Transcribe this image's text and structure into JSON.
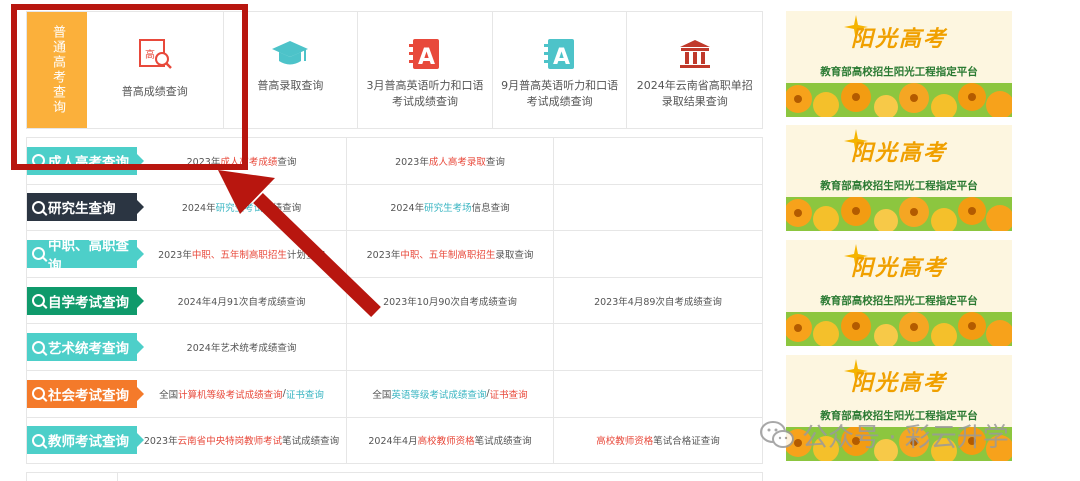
{
  "top_cards": {
    "tab_label": "普通高考查询",
    "cards": [
      {
        "label": "普高成绩查询",
        "icon": "score-search-icon"
      },
      {
        "label": "普高录取查询",
        "icon": "graduation-cap-icon"
      },
      {
        "label": "3月普高英语听力和口语考试成绩查询",
        "icon": "english-a-icon"
      },
      {
        "label": "9月普高英语听力和口语考试成绩查询",
        "icon": "english-a-icon"
      },
      {
        "label": "2024年云南省高职单招录取结果查询",
        "icon": "building-icon"
      }
    ]
  },
  "rows": [
    {
      "category": "成人高考查询",
      "color": "#4dcfc9",
      "c1": {
        "pre": "2023年",
        "hl": "成人高考成绩",
        "post": "查询",
        "hl_class": "hl-red"
      },
      "c2": {
        "pre": "2023年",
        "hl": "成人高考录取",
        "post": "查询",
        "hl_class": "hl-red"
      },
      "c3": null
    },
    {
      "category": "研究生查询",
      "color": "#2b3542",
      "c1": {
        "pre": "2024年",
        "hl": "研究生考试",
        "post": "成绩查询",
        "hl_class": "hl-teal"
      },
      "c2": {
        "pre": "2024年",
        "hl": "研究生考场",
        "post": "信息查询",
        "hl_class": "hl-teal"
      },
      "c3": null
    },
    {
      "category": "中职、高职查询",
      "color": "#4dcfc9",
      "c1": {
        "pre": "2023年",
        "hl": "中职、五年制高职招生",
        "post": "计划查询",
        "hl_class": "hl-red"
      },
      "c2": {
        "pre": "2023年",
        "hl": "中职、五年制高职招生",
        "post": "录取查询",
        "hl_class": "hl-red"
      },
      "c3": null
    },
    {
      "category": "自学考试查询",
      "color": "#0f9a6b",
      "c1": {
        "pre": "2024年4月91次自考成绩查询",
        "hl": "",
        "post": "",
        "hl_class": ""
      },
      "c2": {
        "pre": "2023年10月90次自考成绩查询",
        "hl": "",
        "post": "",
        "hl_class": ""
      },
      "c3": {
        "pre": "2023年4月89次自考成绩查询",
        "hl": "",
        "post": "",
        "hl_class": ""
      }
    },
    {
      "category": "艺术统考查询",
      "color": "#4dcfc9",
      "c1": {
        "pre": "2024年艺术统考成绩查询",
        "hl": "",
        "post": "",
        "hl_class": ""
      },
      "c2": null,
      "c3": null
    },
    {
      "category": "社会考试查询",
      "color": "#f47a2a",
      "c1": {
        "pre": "全国",
        "hl": "计算机等级考试成绩查询",
        "post": " / ",
        "hl2": "证书查询",
        "hl_class": "hl-red",
        "hl2_class": "hl-teal"
      },
      "c2": {
        "pre": "全国",
        "hl": "英语等级考试成绩查询",
        "post": " / ",
        "hl2": "证书查询",
        "hl_class": "hl-teal",
        "hl2_class": "hl-red"
      },
      "c3": null
    },
    {
      "category": "教师考试查询",
      "color": "#4dcfc9",
      "c1": {
        "pre": "2023年",
        "hl": "云南省中央特岗教师考试",
        "post": "笔试成绩查询",
        "hl_class": "hl-red"
      },
      "c2": {
        "pre": "2024年4月",
        "hl": "高校教师资格",
        "post": "笔试成绩查询",
        "hl_class": "hl-red"
      },
      "c3": {
        "pre": "",
        "hl": "高校教师资格",
        "post": "笔试合格证查询",
        "hl_class": "hl-red"
      }
    }
  ],
  "banners": {
    "title": "阳光高考",
    "subtitle": "教育部高校招生阳光工程指定平台",
    "count": 4
  },
  "watermark": "公众号 · 彩云升学"
}
